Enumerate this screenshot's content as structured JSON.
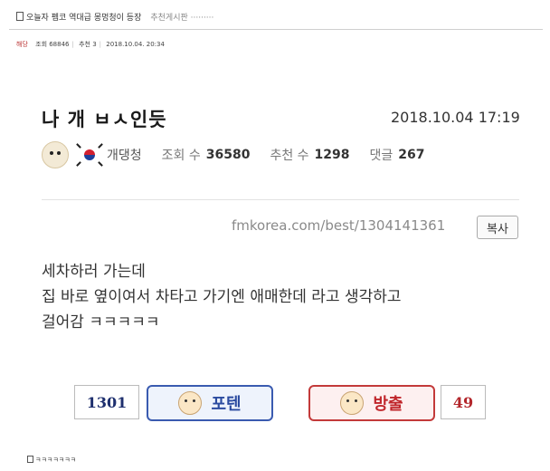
{
  "outer": {
    "post_title": "오늘자 펨코 역대급 몽멍청이 등장",
    "board": "추천게시판 ·········",
    "meta": {
      "category": "해당",
      "views": "조회 68846",
      "recommend": "추천 3",
      "datetime": "2018.10.04. 20:34"
    },
    "footer": "ㅋㅋㅋㅋㅋㅋㅋ"
  },
  "post": {
    "title": "나 개 ㅂㅅ인듯",
    "datetime": "2018.10.04 17:19",
    "author": "개댕청",
    "views_label": "조회 수",
    "views": "36580",
    "recommend_label": "추천 수",
    "recommend": "1298",
    "comments_label": "댓글",
    "comments": "267",
    "url": "fmkorea.com/best/1304141361",
    "copy_label": "복사",
    "body_lines": [
      "세차하러 가는데",
      "집 바로 옆이여서 차타고 가기엔 애매한데 라고 생각하고",
      "걸어감 ㅋㅋㅋㅋㅋ"
    ]
  },
  "vote": {
    "up_count": "1301",
    "up_label": "포텐",
    "down_label": "방출",
    "down_count": "49"
  },
  "colors": {
    "up": "#2b4ba0",
    "down": "#c0262b"
  }
}
